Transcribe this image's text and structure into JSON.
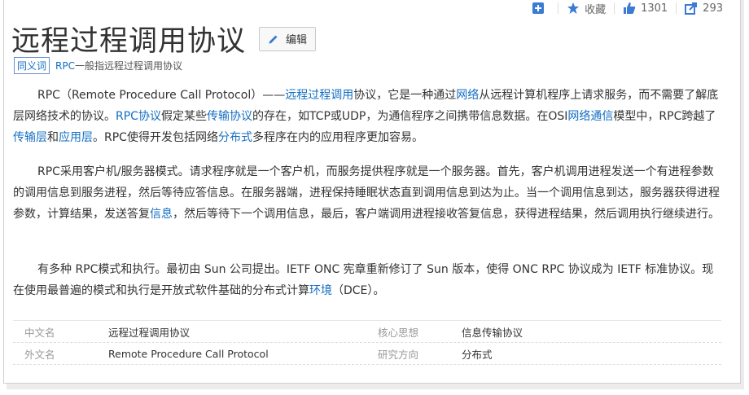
{
  "topbar": {
    "collect_label": "收藏",
    "like_count": "1301",
    "share_count": "293"
  },
  "title": "远程过程调用协议",
  "edit_label": "编辑",
  "synonym": {
    "tag": "同义词",
    "term": "RPC",
    "desc": "一般指远程过程调用协议"
  },
  "para1": {
    "t1": "RPC（Remote Procedure Call Protocol）——",
    "l1": "远程过程调用",
    "t2": "协议，它是一种通过",
    "l2": "网络",
    "t3": "从远程计算机程序上请求服务，而不需要了解底层网络技术的协议。",
    "l3": "RPC协议",
    "t4": "假定某些",
    "l4": "传输协议",
    "t5": "的存在，如TCP或UDP，为通信程序之间携带信息数据。在OSI",
    "l5": "网络通信",
    "t6": "模型中，RPC跨越了",
    "l6": "传输层",
    "t7": "和",
    "l7": "应用层",
    "t8": "。RPC使得开发包括网络",
    "l8": "分布式",
    "t9": "多程序在内的应用程序更加容易。"
  },
  "para2": {
    "t1": "RPC采用客户机/服务器模式。请求程序就是一个客户机，而服务提供程序就是一个服务器。首先，客户机调用进程发送一个有进程参数的调用信息到服务进程，然后等待应答信息。在服务器端，进程保持睡眠状态直到调用信息到达为止。当一个调用信息到达，服务器获得进程参数，计算结果，发送答复",
    "l1": "信息",
    "t2": "，然后等待下一个调用信息，最后，客户端调用进程接收答复信息，获得进程结果，然后调用执行继续进行。"
  },
  "para3": {
    "t1": "有多种 RPC模式和执行。最初由 Sun 公司提出。IETF ONC 宪章重新修订了 Sun 版本，使得 ONC RPC 协议成为 IETF 标准协议。现在使用最普遍的模式和执行是开放式软件基础的分布式计算",
    "l1": "环境",
    "t2": "（DCE）。"
  },
  "info": [
    {
      "label1": "中文名",
      "value1": "远程过程调用协议",
      "label2": "核心思想",
      "value2": "信息传输协议"
    },
    {
      "label1": "外文名",
      "value1": "Remote Procedure Call Protocol",
      "label2": "研究方向",
      "value2": "分布式"
    }
  ],
  "colors": {
    "link": "#136ec2",
    "icon": "#3b7bd4"
  }
}
